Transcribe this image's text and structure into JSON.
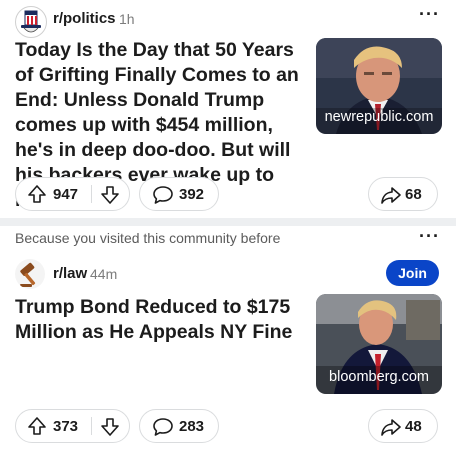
{
  "posts": [
    {
      "subreddit": "r/politics",
      "age": "1h",
      "title": "Today Is the Day that 50 Years of Grifting Finally Comes to an End: Unless Donald Trump comes up with $454 million, he's in deep doo-doo. But will his backers ever wake up to reality?",
      "domain": "newrepublic.com",
      "upvotes": "947",
      "comments": "392",
      "shares": "68"
    },
    {
      "recommendation": "Because you visited this community before",
      "subreddit": "r/law",
      "age": "44m",
      "join_label": "Join",
      "title": "Trump Bond Reduced to $175 Million as He Appeals NY Fine",
      "domain": "bloomberg.com",
      "upvotes": "373",
      "comments": "283",
      "shares": "48"
    }
  ],
  "icons": {
    "more": "more-horizontal-icon",
    "upvote": "arrow-up-icon",
    "downvote": "arrow-down-icon",
    "comment": "speech-bubble-icon",
    "share": "share-arrow-icon"
  },
  "colors": {
    "join_button": "#0a45c8",
    "separator": "#edeff1",
    "muted_text": "#7c7c7c"
  }
}
